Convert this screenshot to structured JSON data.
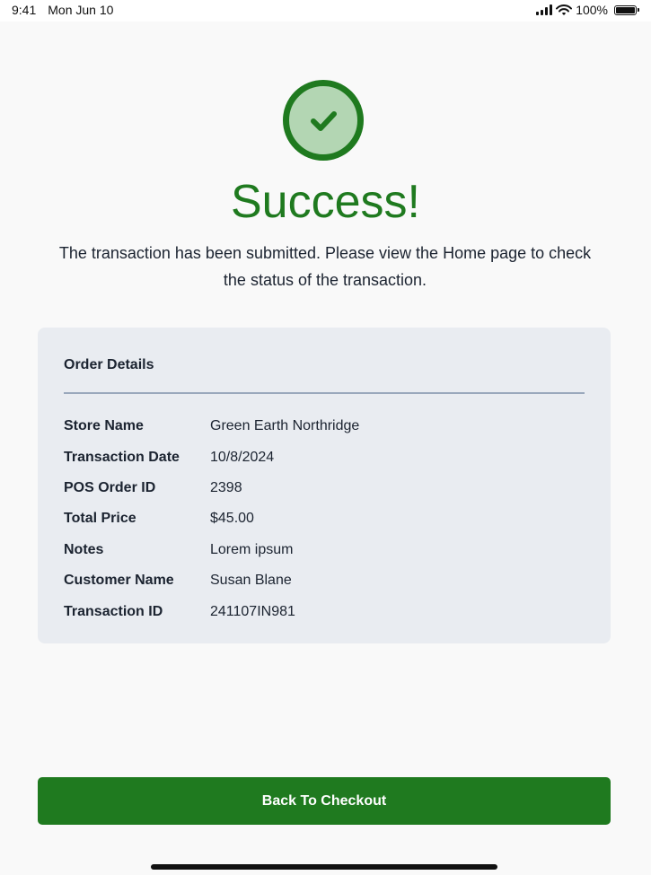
{
  "status_bar": {
    "time": "9:41",
    "date": "Mon Jun 10",
    "battery": "100%",
    "battery_level": 1.0
  },
  "success": {
    "icon": "check-circle-icon",
    "title": "Success!",
    "message": "The transaction has been submitted. Please view the Home page to check the status of the transaction."
  },
  "order_details": {
    "title": "Order Details",
    "rows": [
      {
        "label": "Store Name",
        "value": "Green Earth Northridge"
      },
      {
        "label": "Transaction Date",
        "value": "10/8/2024"
      },
      {
        "label": "POS Order ID",
        "value": "2398"
      },
      {
        "label": "Total Price",
        "value": "$45.00"
      },
      {
        "label": "Notes",
        "value": "Lorem ipsum"
      },
      {
        "label": "Customer Name",
        "value": "Susan Blane"
      },
      {
        "label": "Transaction ID",
        "value": "241107IN981"
      }
    ]
  },
  "actions": {
    "back_label": "Back To Checkout"
  },
  "colors": {
    "accent": "#1F7A1F",
    "accent_light": "#B3D6B3",
    "card_background": "#E9ECF1",
    "divider": "#9AA8BC",
    "page_background": "#F9F9F9"
  }
}
